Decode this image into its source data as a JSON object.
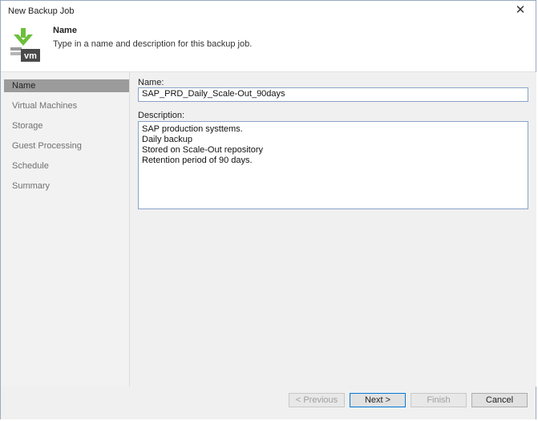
{
  "window": {
    "title": "New Backup Job"
  },
  "header": {
    "title": "Name",
    "subtitle": "Type in a name and description for this backup job.",
    "logo_text": "vm",
    "accent": "#6bbf3a"
  },
  "sidebar": {
    "items": [
      {
        "label": "Name",
        "active": true
      },
      {
        "label": "Virtual Machines",
        "active": false
      },
      {
        "label": "Storage",
        "active": false
      },
      {
        "label": "Guest Processing",
        "active": false
      },
      {
        "label": "Schedule",
        "active": false
      },
      {
        "label": "Summary",
        "active": false
      }
    ]
  },
  "form": {
    "name_label": "Name:",
    "name_value": "SAP_PRD_Daily_Scale-Out_90days",
    "description_label": "Description:",
    "description_lines": [
      "SAP production systtems.",
      "Daily backup",
      "Stored on Scale-Out repository",
      "Retention period of 90 days."
    ]
  },
  "footer": {
    "previous": "< Previous",
    "next": "Next >",
    "finish": "Finish",
    "cancel": "Cancel"
  }
}
